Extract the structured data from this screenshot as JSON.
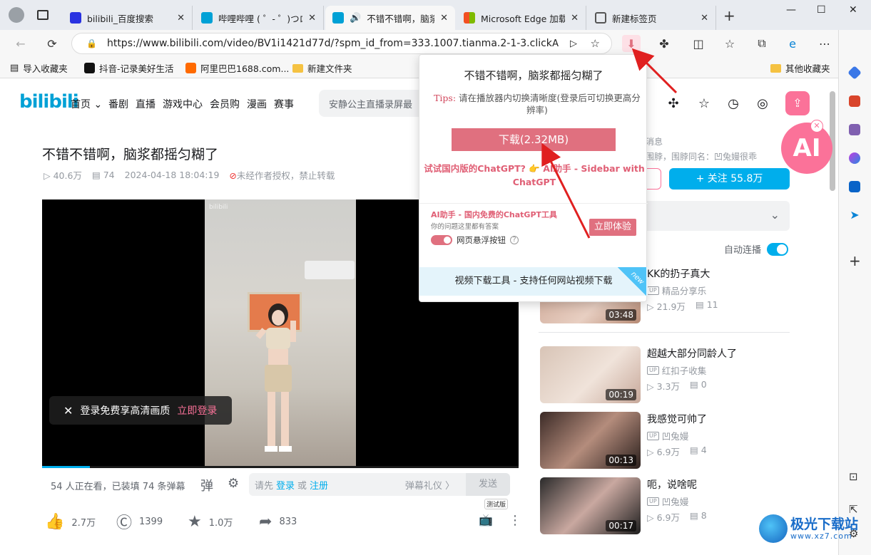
{
  "browser": {
    "tabs": [
      {
        "title": "bilibili_百度搜索",
        "favicon_color": "#2932e1"
      },
      {
        "title": "哔哩哔哩 ( ゜- ゜)つロ 干",
        "favicon_color": "#00a1d6"
      },
      {
        "title": "不错不错啊，脑浆",
        "favicon_color": "#00a1d6"
      },
      {
        "title": "Microsoft Edge 加载项",
        "favicon_color": "#f25022"
      },
      {
        "title": "新建标签页",
        "favicon_color": "#555555"
      }
    ],
    "url": "https://www.bilibili.com/video/BV1i1421d77d/?spm_id_from=333.1007.tianma.2-1-3.click",
    "bookmarks": [
      "导入收藏夹",
      "抖音-记录美好生活",
      "阿里巴巴1688.com...",
      "新建文件夹"
    ],
    "other_bookmarks": "其他收藏夹"
  },
  "bili": {
    "nav": [
      "首页",
      "番剧",
      "直播",
      "游戏中心",
      "会员购",
      "漫画",
      "赛事"
    ],
    "search_placeholder": "安静公主直播录屏最",
    "video_title": "不错不错啊，脑浆都摇匀糊了",
    "views": "40.6万",
    "danmaku_count": "74",
    "date": "2024-04-18 18:04:19",
    "copyright": "未经作者授权，禁止转载",
    "login_prompt": "登录免费享高清画质",
    "login_link": "立即登录",
    "watching": "54 人正在看，已装填 74 条弹幕",
    "dm_prefix": "请先",
    "dm_login": "登录",
    "dm_or": "或",
    "dm_register": "注册",
    "dm_gift": "弹幕礼仪 〉",
    "dm_send": "发送",
    "likes": "2.7万",
    "coins": "1399",
    "favs": "1.0万",
    "shares": "833",
    "test_label": "测试版",
    "up_info_1": "消息",
    "up_info_2": "围脖，围脖同名：凹兔嫚很乖",
    "follow": "+ 关注 55.8万",
    "autoplay": "自动连播",
    "recommendations": [
      {
        "title": "KK的扔子真大",
        "up": "精品分享乐",
        "views": "21.9万",
        "dm": "11",
        "duration": "03:48"
      },
      {
        "title": "超越大部分同龄人了",
        "up": "红扣子收集",
        "views": "3.3万",
        "dm": "0",
        "duration": "00:19"
      },
      {
        "title": "我感觉可帅了",
        "up": "凹兔嫚",
        "views": "6.9万",
        "dm": "4",
        "duration": "00:13"
      },
      {
        "title": "呃，说啥呢",
        "up": "凹兔嫚",
        "views": "6.9万",
        "dm": "8",
        "duration": "00:17"
      }
    ]
  },
  "popup": {
    "title": "不错不错啊，脑浆都摇匀糊了",
    "tips_label": "Tips:",
    "tips": "请在播放器内切换清晰度(登录后可切换更高分辨率)",
    "download": "下载(2.32MB)",
    "gpt_line": "试试国内版的ChatGPT? 👉 AI助手 - Sidebar with ChatGPT",
    "ai_title": "AI助手 - 国内免费的ChatGPT工具",
    "ai_sub": "你的问题这里都有答案",
    "float_toggle": "网页悬浮按钮",
    "try_now": "立即体验",
    "bottom": "视频下载工具 - 支持任何网站视频下载",
    "new": "new"
  },
  "ai_float": "AI",
  "watermark": {
    "title": "极光下载站",
    "url": "www.xz7.com"
  }
}
